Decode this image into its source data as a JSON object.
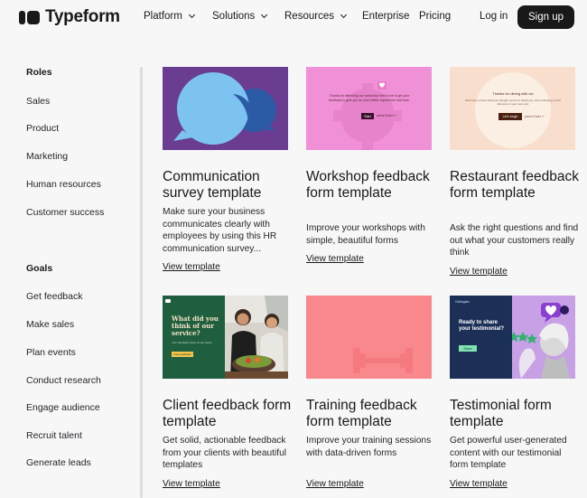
{
  "header": {
    "logo_text": "Typeform",
    "nav": [
      "Platform",
      "Solutions",
      "Resources",
      "Enterprise",
      "Pricing"
    ],
    "login": "Log in",
    "signup": "Sign up"
  },
  "sidebar": {
    "roles_heading": "Roles",
    "roles": [
      "Sales",
      "Product",
      "Marketing",
      "Human resources",
      "Customer success"
    ],
    "goals_heading": "Goals",
    "goals": [
      "Get feedback",
      "Make sales",
      "Plan events",
      "Conduct research",
      "Engage audience",
      "Recruit talent",
      "Generate leads"
    ]
  },
  "cards": [
    {
      "title": "Communication survey template",
      "desc": "Make sure your business communicates clearly with employees by using this HR communication survey...",
      "link": "View template"
    },
    {
      "title": "Workshop feedback form template",
      "desc": "Improve your workshops with simple, beautiful forms",
      "link": "View template",
      "thumb": {
        "text": "Thanks for attending our workshop! We'd love to get your feedback to give you an even better experience next time.",
        "button": "Start",
        "hint": "press Enter ↵"
      }
    },
    {
      "title": "Restaurant feedback form template",
      "desc": "Ask the right questions and find out what your customers really think",
      "link": "View template",
      "thumb": {
        "text": "Thanks for dining with us!",
        "subtext": "We'd love to know what you thought, and as a thank-you, we're including a 10% discount on your next visit.",
        "button": "Let's begin",
        "hint": "press Enter ↵"
      }
    },
    {
      "title": "Client feedback form template",
      "desc": "Get solid, actionable feedback from your clients with beautiful templates",
      "link": "View template",
      "thumb": {
        "heading": "What did you think of our service?",
        "subtext": "Your feedback helps us get better.",
        "button": "Give feedback"
      }
    },
    {
      "title": "Training feedback form template",
      "desc": "Improve your training sessions with data-driven forms",
      "link": "View template"
    },
    {
      "title": "Testimonial form template",
      "desc": "Get powerful user-generated content with our testimonial form template",
      "link": "View template",
      "thumb": {
        "brand": "Ceilingfan",
        "heading": "Ready to share your testimonial?",
        "button": "Share"
      }
    }
  ],
  "colors": {
    "dark": "#191919",
    "comm_bg": "#6a3d93",
    "comm_bubble_light": "#7cc3f2",
    "comm_bubble_dark": "#2c5ba6",
    "workshop_bg": "#f090d6",
    "restaurant_bg": "#f8dfcd",
    "client_green": "#1f5e3f",
    "training_bg": "#f9888c",
    "testimonial_navy": "#1c3057",
    "testimonial_purple": "#c7a0e6"
  }
}
